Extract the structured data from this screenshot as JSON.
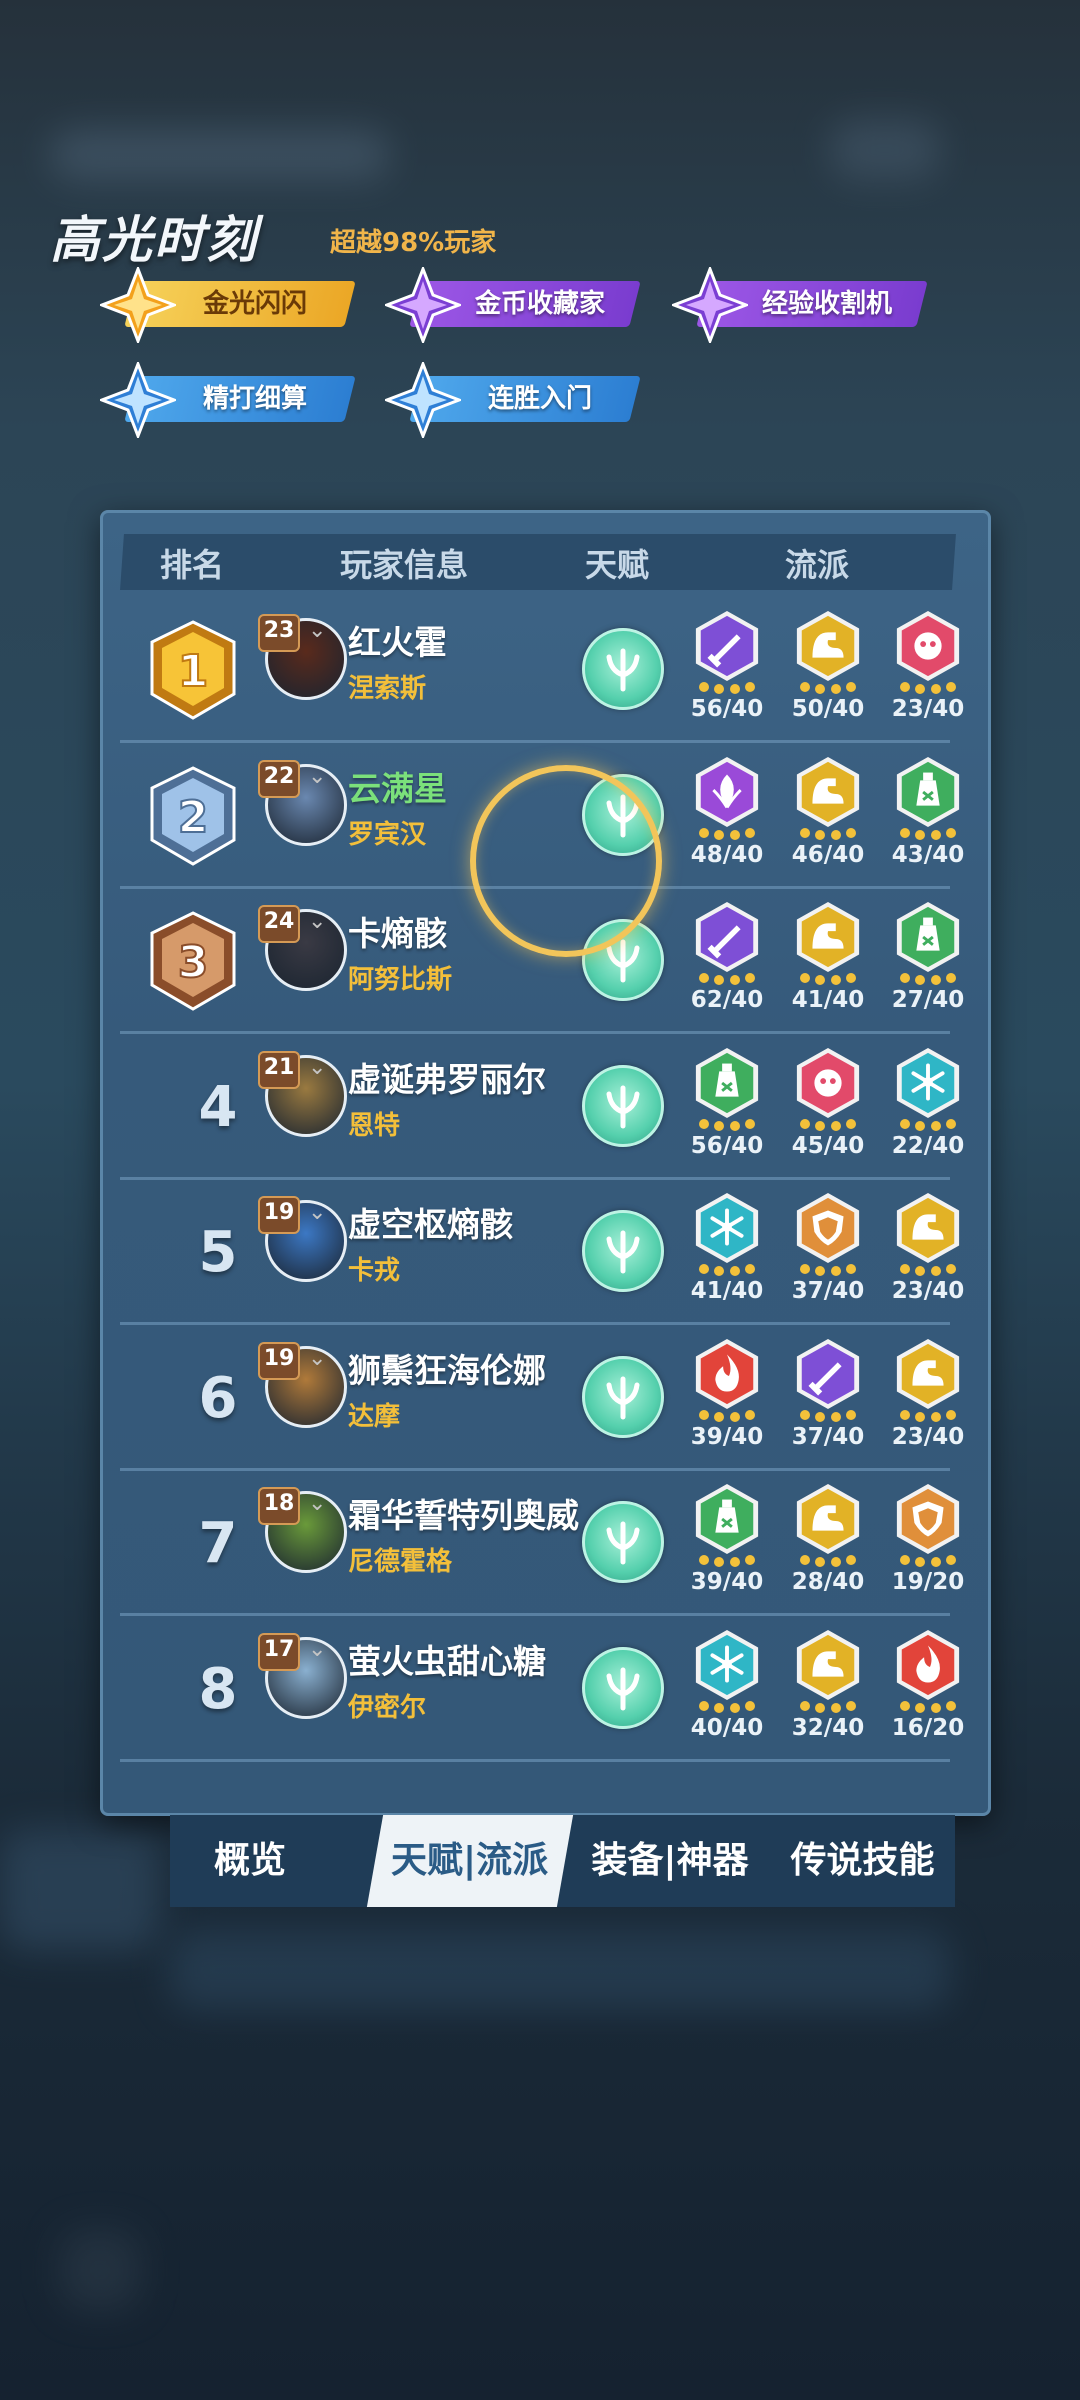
{
  "header": {
    "title": "高光时刻",
    "subtitle": "超越98%玩家"
  },
  "badges": [
    {
      "label": "金光闪闪",
      "style": "gold"
    },
    {
      "label": "金币收藏家",
      "style": "purple"
    },
    {
      "label": "经验收割机",
      "style": "purple"
    },
    {
      "label": "精打细算",
      "style": "blue"
    },
    {
      "label": "连胜入门",
      "style": "blue"
    }
  ],
  "table": {
    "headers": {
      "rank": "排名",
      "player": "玩家信息",
      "talent": "天赋",
      "faction": "流派"
    },
    "rows": [
      {
        "rank": "1",
        "level": "23",
        "name": "红火霍",
        "hero": "涅索斯",
        "traits": [
          [
            "sword",
            "56/40"
          ],
          [
            "muscle",
            "50/40"
          ],
          [
            "face",
            "23/40"
          ]
        ]
      },
      {
        "rank": "2",
        "level": "22",
        "name": "云满星",
        "hero": "罗宾汉",
        "traits": [
          [
            "leaf",
            "48/40"
          ],
          [
            "muscle",
            "46/40"
          ],
          [
            "potion",
            "43/40"
          ]
        ]
      },
      {
        "rank": "3",
        "level": "24",
        "name": "卡熵骸",
        "hero": "阿努比斯",
        "traits": [
          [
            "sword",
            "62/40"
          ],
          [
            "muscle",
            "41/40"
          ],
          [
            "potion",
            "27/40"
          ]
        ]
      },
      {
        "rank": "4",
        "level": "21",
        "name": "虚诞弗罗丽尔",
        "hero": "恩特",
        "traits": [
          [
            "potion",
            "56/40"
          ],
          [
            "face",
            "45/40"
          ],
          [
            "snow",
            "22/40"
          ]
        ]
      },
      {
        "rank": "5",
        "level": "19",
        "name": "虚空枢熵骸",
        "hero": "卡戎",
        "traits": [
          [
            "snow",
            "41/40"
          ],
          [
            "shield",
            "37/40"
          ],
          [
            "muscle",
            "23/40"
          ]
        ]
      },
      {
        "rank": "6",
        "level": "19",
        "name": "狮鬃狂海伦娜",
        "hero": "达摩",
        "traits": [
          [
            "fire",
            "39/40"
          ],
          [
            "sword",
            "37/40"
          ],
          [
            "muscle",
            "23/40"
          ]
        ]
      },
      {
        "rank": "7",
        "level": "18",
        "name": "霜华誓特列奥威",
        "hero": "尼德霍格",
        "traits": [
          [
            "potion",
            "39/40"
          ],
          [
            "muscle",
            "28/40"
          ],
          [
            "shield",
            "19/20"
          ]
        ]
      },
      {
        "rank": "8",
        "level": "17",
        "name": "萤火虫甜心糖",
        "hero": "伊密尔",
        "traits": [
          [
            "snow",
            "40/40"
          ],
          [
            "muscle",
            "32/40"
          ],
          [
            "fire",
            "16/20"
          ]
        ]
      }
    ]
  },
  "tabs": [
    {
      "label": "概览",
      "active": false
    },
    {
      "label": "天赋|流派",
      "active": true
    },
    {
      "label": "装备|神器",
      "active": false
    },
    {
      "label": "传说技能",
      "active": false
    }
  ],
  "colors": {
    "sword": "#7e4fd6",
    "muscle": "#e2b226",
    "face": "#e24a6a",
    "leaf": "#9a4ad8",
    "potion": "#3fae5e",
    "snow": "#2fb6c6",
    "shield": "#e08f3a",
    "fire": "#e2443a"
  }
}
